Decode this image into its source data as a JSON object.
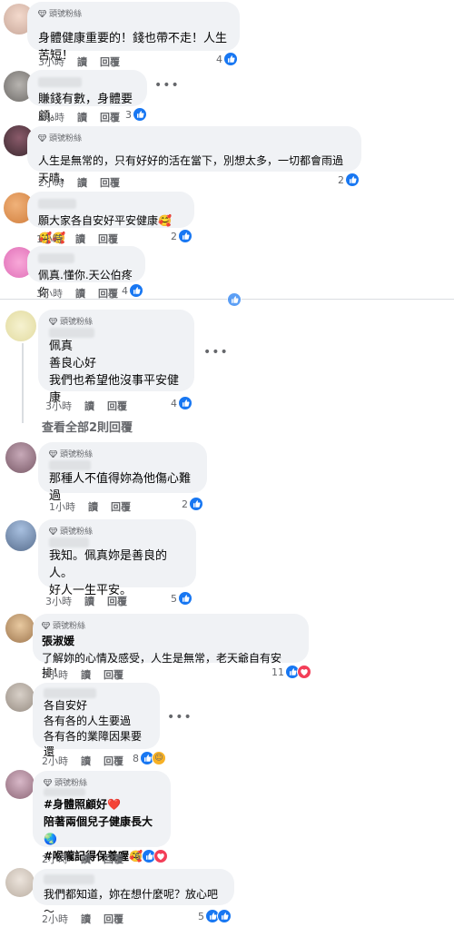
{
  "badge_label": "頭號粉絲",
  "action_read": "讀",
  "action_reply": "回覆",
  "comments": [
    {
      "time": "3小時",
      "text": "身體健康重要的！錢也帶不走！人生苦短！",
      "count": "4",
      "badge": true
    },
    {
      "time": "2小時",
      "text": "賺錢有數，身體要顧。",
      "count": "3",
      "badge": false
    },
    {
      "time": "2小時",
      "text": "人生是無常的，只有好好的活在當下，別想太多，一切都會雨過天晴，",
      "count": "2",
      "badge": true
    },
    {
      "time": "1小時",
      "text": "願大家各自安好平安健康🥰🥰🥰",
      "count": "2",
      "badge": false
    },
    {
      "time": "3小時",
      "text": "佩真.懂你.天公伯疼你",
      "count": "4",
      "badge": false
    },
    {
      "time": "3小時",
      "text": "佩真\n善良心好\n我們也希望他沒事平安健康",
      "count": "4",
      "badge": true
    },
    {
      "time": "1小時",
      "text": "那種人不值得妳為他傷心難過",
      "count": "2",
      "badge": true
    },
    {
      "time": "3小時",
      "text": "我知。佩真妳是善良的人。\n好人一生平安。",
      "count": "5",
      "badge": true
    },
    {
      "time": "3小時",
      "name": "張淑媛",
      "text": "了解妳的心情及感受，人生是無常，老天爺自有安排！",
      "count": "11",
      "badge": true
    },
    {
      "time": "2小時",
      "text": "各自安好\n各有各的人生要過\n各有各的業障因果要還",
      "count": "8",
      "badge": false
    },
    {
      "time": "2小時",
      "text": "#身體照顧好❤️\n陪著兩個兒子健康長大🌏\n#喉嚨記得保養喔🥰",
      "count": "6",
      "badge": true
    },
    {
      "time": "2小時",
      "text": "我們都知道，妳在想什麼呢？放心吧～",
      "count": "5",
      "badge": false
    }
  ],
  "view_more": "查看全部2則回覆",
  "icons": {
    "like": "thumb-up-icon",
    "love": "heart-icon",
    "care": "care-icon",
    "badge": "diamond-icon",
    "more": "more-dots-icon"
  },
  "colors": {
    "like": "#1877f2",
    "love": "#f33e58",
    "care": "#f7b125",
    "bubble": "#f0f2f5"
  }
}
